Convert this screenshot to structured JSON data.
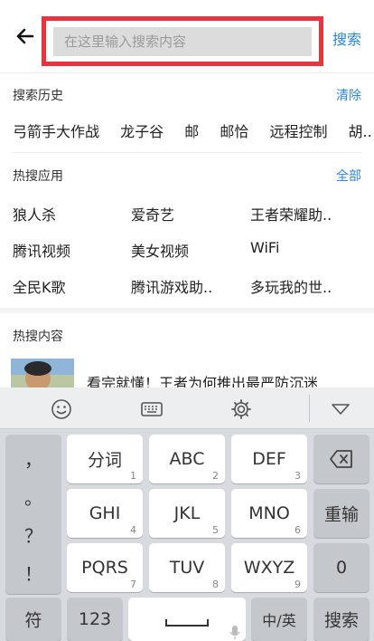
{
  "search": {
    "placeholder": "在这里输入搜索内容",
    "button_label": "搜索"
  },
  "history": {
    "title": "搜索历史",
    "action": "清除",
    "items": [
      "弓箭手大作战",
      "龙子谷",
      "邮",
      "邮恰",
      "远程控制",
      "胡.."
    ]
  },
  "hot_apps": {
    "title": "热搜应用",
    "action": "全部",
    "items": [
      [
        "狼人杀",
        "爱奇艺",
        "王者荣耀助.."
      ],
      [
        "腾讯视频",
        "美女视频",
        "WiFi"
      ],
      [
        "全民K歌",
        "腾讯游戏助..",
        "多玩我的世.."
      ]
    ]
  },
  "hot_content": {
    "title": "热搜内容",
    "first_item": "看完就懂！王者为何推出最严防沉迷"
  },
  "keyboard": {
    "toolbar_icons": [
      "emoji-icon",
      "keyboard-icon",
      "settings-icon",
      "collapse-icon"
    ],
    "symbols": [
      "，",
      "。",
      "？",
      "！"
    ],
    "rows": [
      [
        {
          "label": "分词",
          "num": "1"
        },
        {
          "label": "ABC",
          "num": "2"
        },
        {
          "label": "DEF",
          "num": "3"
        }
      ],
      [
        {
          "label": "GHI",
          "num": "4"
        },
        {
          "label": "JKL",
          "num": "5"
        },
        {
          "label": "MNO",
          "num": "6"
        }
      ],
      [
        {
          "label": "PQRS",
          "num": "7"
        },
        {
          "label": "TUV",
          "num": "8"
        },
        {
          "label": "WXYZ",
          "num": "9"
        }
      ]
    ],
    "right_keys": [
      "⌫",
      "重输",
      "0"
    ],
    "bottom": {
      "sym": "符",
      "num": "123",
      "lang": "中/英",
      "search": "搜索"
    }
  }
}
